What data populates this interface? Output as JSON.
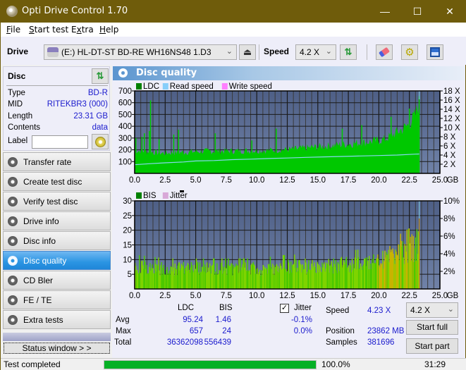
{
  "window": {
    "title": "Opti Drive Control 1.70",
    "minimize": "—",
    "maximize": "☐",
    "close": "✕"
  },
  "menu": [
    {
      "label": "File",
      "u": "F",
      "rest": "ile"
    },
    {
      "label": "Start test",
      "u": "S",
      "rest": "tart test"
    },
    {
      "label": "Extra",
      "u": "x",
      "pre": "E",
      "rest": "tra"
    },
    {
      "label": "Help",
      "u": "H",
      "rest": "elp"
    }
  ],
  "toolbar": {
    "drive_label": "Drive",
    "drive_value": "(E:)  HL-DT-ST BD-RE  WH16NS48 1.D3",
    "speed_label": "Speed",
    "speed_value": "4.2 X"
  },
  "disc": {
    "header": "Disc",
    "type_label": "Type",
    "type_value": "BD-R",
    "mid_label": "MID",
    "mid_value": "RITEKBR3 (000)",
    "length_label": "Length",
    "length_value": "23.31 GB",
    "contents_label": "Contents",
    "contents_value": "data",
    "label_label": "Label",
    "label_value": ""
  },
  "nav": [
    {
      "label": "Transfer rate",
      "active": false
    },
    {
      "label": "Create test disc",
      "active": false
    },
    {
      "label": "Verify test disc",
      "active": false
    },
    {
      "label": "Drive info",
      "active": false
    },
    {
      "label": "Disc info",
      "active": false
    },
    {
      "label": "Disc quality",
      "active": true
    },
    {
      "label": "CD Bler",
      "active": false
    },
    {
      "label": "FE / TE",
      "active": false
    },
    {
      "label": "Extra tests",
      "active": false
    }
  ],
  "status_window_button": "Status window > >",
  "panel_title": "Disc quality",
  "chart_data": [
    {
      "type": "area",
      "title": "LDC",
      "legend": [
        "LDC",
        "Read speed",
        "Write speed"
      ],
      "legend_colors": {
        "LDC": "#008000",
        "Read speed": "#87cefa",
        "Write speed": "#ff80ff"
      },
      "xlabel": "GB",
      "x_ticks": [
        "0.0",
        "2.5",
        "5.0",
        "7.5",
        "10.0",
        "12.5",
        "15.0",
        "17.5",
        "20.0",
        "22.5",
        "25.0"
      ],
      "xlim": [
        0,
        25
      ],
      "y_ticks": [
        "100",
        "200",
        "300",
        "400",
        "500",
        "600",
        "700"
      ],
      "ylim": [
        0,
        700
      ],
      "y2_ticks": [
        "2 X",
        "4 X",
        "6 X",
        "8 X",
        "10 X",
        "12 X",
        "14 X",
        "16 X",
        "18 X"
      ],
      "y2lim": [
        0,
        18
      ],
      "ldc_x": [
        0,
        0.5,
        1.0,
        1.5,
        2.0,
        2.5,
        3.0,
        4.0,
        5.0,
        6.0,
        7.0,
        8.0,
        9.0,
        10.0,
        11.0,
        12.0,
        13.0,
        14.0,
        15.0,
        16.0,
        17.0,
        18.0,
        19.0,
        20.0,
        20.5,
        21.0,
        21.5,
        22.0,
        22.5,
        23.0,
        23.31
      ],
      "ldc_base": [
        195,
        190,
        185,
        180,
        175,
        172,
        175,
        180,
        185,
        188,
        190,
        190,
        192,
        192,
        195,
        200,
        205,
        215,
        225,
        235,
        245,
        255,
        265,
        280,
        290,
        320,
        350,
        380,
        420,
        500,
        600
      ],
      "ldc_spikes": [
        [
          0.1,
          300
        ],
        [
          0.6,
          310
        ],
        [
          0.8,
          340
        ],
        [
          1.3,
          620
        ],
        [
          1.2,
          360
        ],
        [
          2.0,
          290
        ],
        [
          3.2,
          330
        ],
        [
          3.6,
          370
        ],
        [
          6.6,
          340
        ],
        [
          9.6,
          280
        ],
        [
          11.6,
          380
        ],
        [
          17.0,
          380
        ],
        [
          18.6,
          410
        ],
        [
          21.0,
          480
        ],
        [
          22.5,
          550
        ],
        [
          23.3,
          657
        ]
      ],
      "read_speed_x": [
        0,
        1.2,
        2.5,
        4.0,
        5.0,
        6.5,
        8.0,
        9.5,
        11.0,
        12.5,
        14.0,
        15.5,
        17.0,
        18.5,
        20.0,
        21.5,
        23.0,
        23.31
      ],
      "read_speed_y": [
        1.9,
        2.1,
        2.3,
        2.5,
        2.7,
        2.8,
        3.0,
        3.1,
        3.25,
        3.35,
        3.5,
        3.6,
        3.7,
        3.8,
        3.9,
        4.0,
        4.2,
        4.23
      ]
    },
    {
      "type": "bar",
      "title": "BIS",
      "legend": [
        "BIS",
        "Jitter"
      ],
      "legend_colors": {
        "BIS": "#008000",
        "Jitter": "#d8a8d8"
      },
      "xlabel": "GB",
      "x_ticks": [
        "0.0",
        "2.5",
        "5.0",
        "7.5",
        "10.0",
        "12.5",
        "15.0",
        "17.5",
        "20.0",
        "22.5",
        "25.0"
      ],
      "xlim": [
        0,
        25
      ],
      "y_ticks": [
        "5",
        "10",
        "15",
        "20",
        "25",
        "30"
      ],
      "ylim": [
        0,
        30
      ],
      "y2_ticks": [
        "2%",
        "4%",
        "6%",
        "8%",
        "10%"
      ],
      "y2lim": [
        0,
        10
      ],
      "bis_envelope_x": [
        0,
        2.5,
        5.0,
        7.5,
        10.0,
        12.5,
        15.0,
        17.5,
        20.0,
        21.0,
        22.0,
        23.0,
        23.31
      ],
      "bis_envelope_y": [
        9,
        8,
        8,
        8,
        8,
        9,
        9,
        10,
        11,
        13,
        15,
        17,
        20
      ],
      "bis_max": 24
    }
  ],
  "stats": {
    "col_ldc": "LDC",
    "col_bis": "BIS",
    "jitter_label": "Jitter",
    "jitter_checked": true,
    "avg_label": "Avg",
    "avg_ldc": "95.24",
    "avg_bis": "1.46",
    "avg_jitter": "-0.1%",
    "max_label": "Max",
    "max_ldc": "657",
    "max_bis": "24",
    "max_jitter": "0.0%",
    "total_label": "Total",
    "total_ldc": "36362098",
    "total_bis": "556439",
    "speed_label": "Speed",
    "speed_value": "4.23 X",
    "position_label": "Position",
    "position_value": "23862 MB",
    "samples_label": "Samples",
    "samples_value": "381696",
    "speed_select": "4.2 X",
    "start_full": "Start full",
    "start_part": "Start part"
  },
  "statusbar": {
    "text": "Test completed",
    "progress": 100.0,
    "progress_text": "100.0%",
    "time": "31:29"
  }
}
